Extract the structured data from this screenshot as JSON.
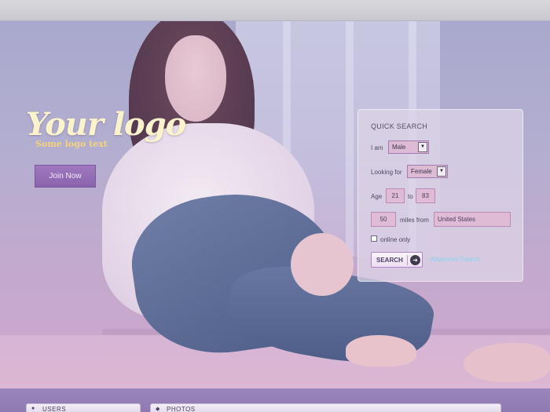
{
  "logo": {
    "title": "Your logo",
    "subtitle": "Some logo text"
  },
  "join_button": "Join Now",
  "quick_search": {
    "title": "QUICK SEARCH",
    "i_am_label": "I am",
    "i_am_value": "Male",
    "looking_for_label": "Looking for",
    "looking_for_value": "Female",
    "age_label": "Age",
    "age_from": "21",
    "age_to_label": "to",
    "age_to": "83",
    "distance": "50",
    "miles_from_label": "miles from",
    "location": "United States",
    "online_only_label": "online only",
    "search_button": "SEARCH",
    "advanced_link": "Advanced Search"
  },
  "bottom_tabs": [
    {
      "label": "USERS",
      "icon": "user-pin-icon"
    },
    {
      "label": "PHOTOS",
      "icon": "photo-diamond-icon"
    }
  ]
}
